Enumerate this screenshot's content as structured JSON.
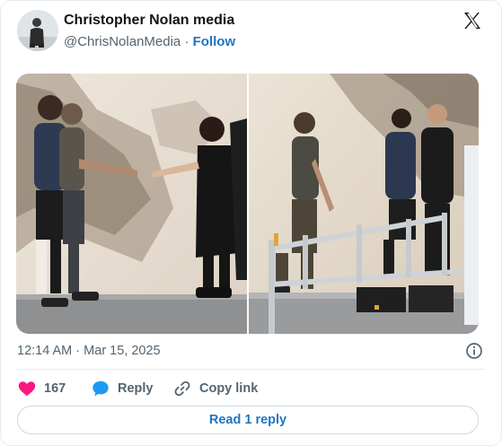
{
  "author": {
    "name": "Christopher Nolan media",
    "handle": "@ChrisNolanMedia",
    "separator": "·",
    "follow_label": "Follow"
  },
  "logo_icon": "x-logo-icon",
  "media": {
    "images": [
      {
        "name": "photo-handshake-dunes"
      },
      {
        "name": "photo-actors-walkway-dunes"
      }
    ]
  },
  "meta": {
    "time": "12:14 AM",
    "separator": "·",
    "date": "Mar 15, 2025"
  },
  "actions": {
    "like_count": "167",
    "reply_label": "Reply",
    "copy_label": "Copy link"
  },
  "read_replies_label": "Read 1 reply",
  "colors": {
    "accent": "#1d75c3",
    "like": "#f91880",
    "muted": "#536471",
    "text": "#0f1419"
  }
}
